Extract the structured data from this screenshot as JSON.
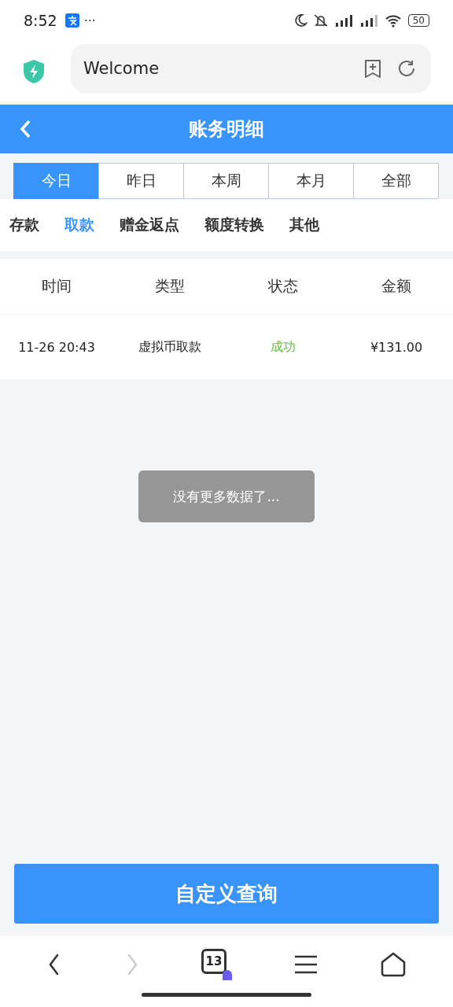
{
  "status_bar": {
    "time": "8:52",
    "more": "···",
    "battery": "50"
  },
  "browser": {
    "address": "Welcome"
  },
  "header": {
    "title": "账务明细"
  },
  "date_tabs": [
    {
      "label": "今日",
      "selected": true
    },
    {
      "label": "昨日",
      "selected": false
    },
    {
      "label": "本周",
      "selected": false
    },
    {
      "label": "本月",
      "selected": false
    },
    {
      "label": "全部",
      "selected": false
    }
  ],
  "category_tabs": [
    {
      "label": "存款",
      "selected": false
    },
    {
      "label": "取款",
      "selected": true
    },
    {
      "label": "赠金返点",
      "selected": false
    },
    {
      "label": "额度转换",
      "selected": false
    },
    {
      "label": "其他",
      "selected": false
    }
  ],
  "table": {
    "columns": [
      "时间",
      "类型",
      "状态",
      "金额"
    ],
    "rows": [
      {
        "time": "11-26 20:43",
        "type": "虚拟币取款",
        "status": "成功",
        "amount": "¥131.00"
      }
    ]
  },
  "toast": "没有更多数据了...",
  "query_button": "自定义查询",
  "nav": {
    "tabs_count": "13",
    "forward_disabled": true
  }
}
